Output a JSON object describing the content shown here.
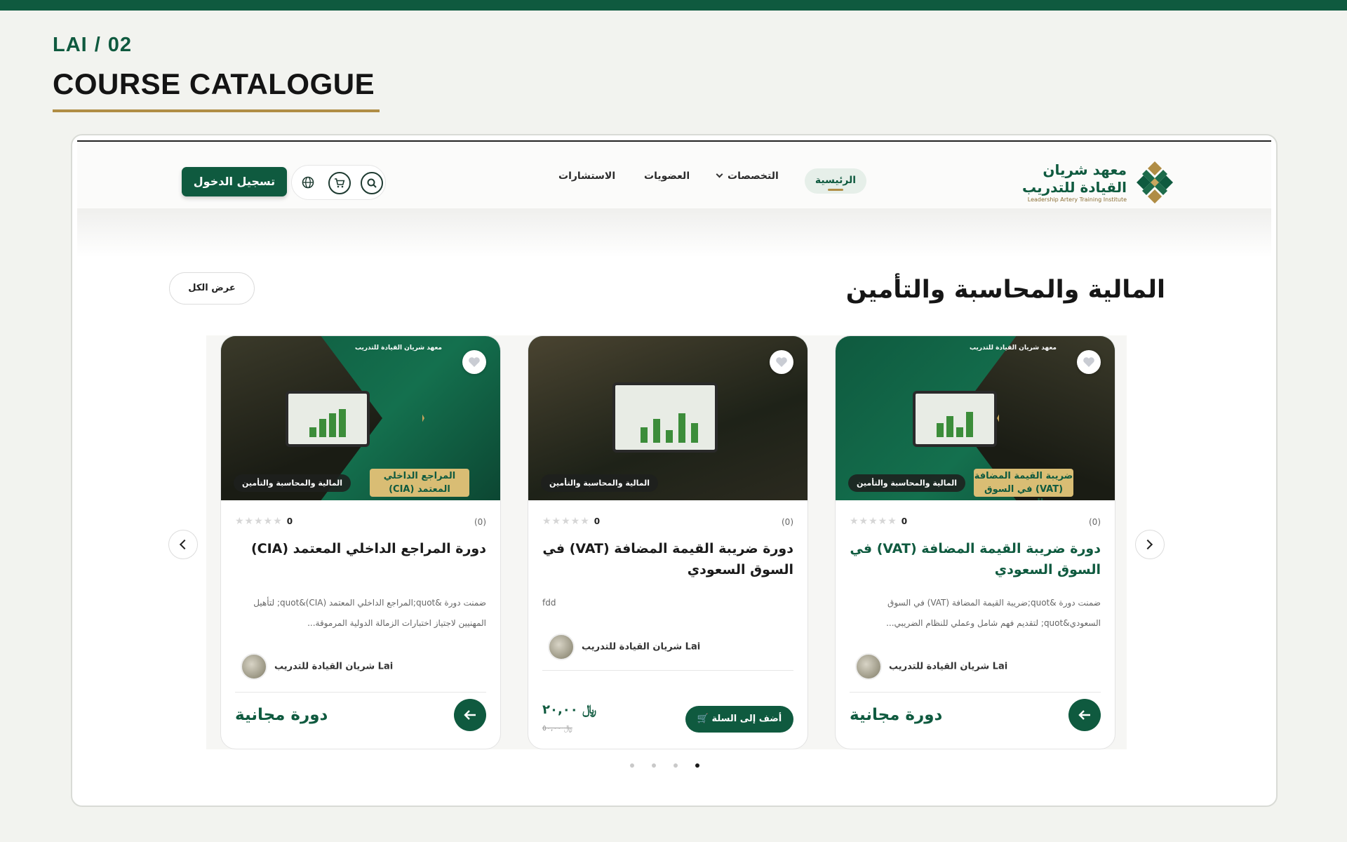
{
  "slide": {
    "code": "LAI",
    "separator": "/",
    "number": "02",
    "heading": "COURSE CATALOGUE"
  },
  "colors": {
    "brand_green": "#0f5a3f",
    "gold": "#b08d45",
    "background": "#f2f3ef"
  },
  "site": {
    "logo": {
      "line1": "معهد شريان",
      "line2": "القيادة للتدريب",
      "tagline": "Leadership Artery Training Institute"
    },
    "nav": {
      "home": "الرئيسية",
      "specializations": "التخصصات",
      "memberships": "العضويات",
      "consultations": "الاستشارات"
    },
    "icons": {
      "search": "search-icon",
      "cart": "cart-icon",
      "language": "globe-icon"
    },
    "login": "تسجيل الدخول"
  },
  "section": {
    "title": "المالية والمحاسبة والتأمين",
    "view_all": "عرض الكل"
  },
  "courses": [
    {
      "image_category": "المالية والمحاسبة والتأمين",
      "image_title": "ضريبة القيمة المضافة (VAT) في السوق السعودي",
      "image_brand": "معهد شريان القيادة للتدريب",
      "rating_count": "(0)",
      "rating": "0",
      "title": "دورة ضريبة القيمة المضافة (VAT) في السوق السعودي",
      "description": "ضمنت دورة &quot;ضريبة القيمة المضافة (VAT) في السوق السعودي&quot; لتقديم فهم شامل وعملي للنظام الضريبي...",
      "author": "شريان القيادة للتدريب Lai",
      "price_label": "دورة مجانية"
    },
    {
      "image_category": "المالية والمحاسبة والتأمين",
      "rating_count": "(0)",
      "rating": "0",
      "title": "دورة ضريبة القيمة المضافة (VAT) في السوق السعودي",
      "description": "fdd",
      "author": "شريان القيادة للتدريب Lai",
      "price": "٢٠,٠٠",
      "old_price": "٥٠,٠٠",
      "add_to_cart": "أضف إلى السلة"
    },
    {
      "image_category": "المالية والمحاسبة والتأمين",
      "image_title": "المراجع الداخلي المعتمد (CIA)",
      "image_brand": "معهد شريان القيادة للتدريب",
      "rating_count": "(0)",
      "rating": "0",
      "title": "دورة المراجع الداخلي المعتمد (CIA)",
      "description": "ضمنت دورة &quot;المراجع الداخلي المعتمد (CIA)&quot; لتأهيل المهنيين لاجتياز اختبارات الزمالة الدولية المرموقة...",
      "author": "شريان القيادة للتدريب Lai",
      "price_label": "دورة مجانية"
    }
  ],
  "carousel": {
    "active_dot": 4,
    "dot_count": 4,
    "prev_icon": "chevron-left-icon",
    "next_icon": "chevron-right-icon"
  }
}
